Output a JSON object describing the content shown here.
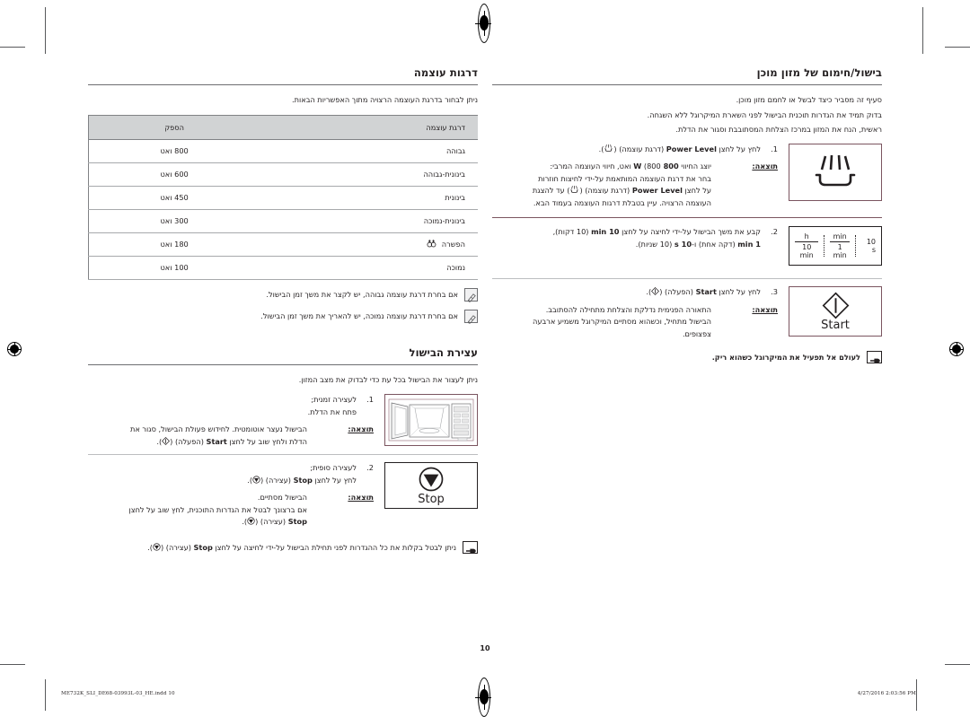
{
  "document": {
    "page_number": "10",
    "footer_filename": "ME732K_SLI_DE68-03993L-03_HE.indd   10",
    "footer_timestamp": "4/27/2016   2:03:56 PM"
  },
  "left_column": {
    "power_section": {
      "title": "דרגות עוצמה",
      "intro": "ניתן לבחור בדרגת העוצמה הרצויה מתוך האפשריות הבאות.",
      "table": {
        "headers": [
          "דרגת עוצמה",
          "הספק"
        ],
        "rows": [
          {
            "level": "גבוהה",
            "level_icon": "",
            "power": "800 ואט"
          },
          {
            "level": "בינונית-גבוהה",
            "level_icon": "",
            "power": "600 ואט"
          },
          {
            "level": "בינונית",
            "level_icon": "",
            "power": "450 ואט"
          },
          {
            "level": "בינונית-נמוכה",
            "level_icon": "",
            "power": "300 ואט"
          },
          {
            "level": "הפשרה",
            "level_icon": "defrost-icon",
            "power": "180 ואט"
          },
          {
            "level": "נמוכה",
            "level_icon": "",
            "power": "100 ואט"
          }
        ]
      },
      "notes": [
        "אם בחרת דרגת עוצמה גבוהה, יש לקצר את משך זמן הבישול.",
        "אם בחרת דרגת עוצמה נמוכה, יש להאריך את משך זמן הבישול."
      ]
    },
    "stop_section": {
      "title": "עצירת הבישול",
      "intro": "ניתן לעצור את הבישול בכל עת כדי לבדוק את מצב המזון.",
      "steps": [
        {
          "num": "1.",
          "lines": [
            "לעצירה זמנית;",
            "פתח את הדלת."
          ],
          "result_label": "תוצאה:",
          "result_lines": [
            "הבישול נעצר אוטומטית. לחידוש פעולת הבישול, סגור את",
            "הדלת ולחץ שוב על לחצן Start (הפעלה) (   )."
          ],
          "figure": "microwave-open-door"
        },
        {
          "num": "2.",
          "lines": [
            "לעצירה סופית;",
            "לחץ על לחצן Stop (עצירה) (   )."
          ],
          "result_label": "תוצאה:",
          "result_lines": [
            "הבישול מסתיים.",
            "אם ברצונך לבטל את הגדרות התוכנית, לחץ שוב על לחצן",
            "Stop (עצירה) (   )."
          ],
          "figure": "stop-button"
        }
      ],
      "final_note": "ניתן לבטל בקלות את כל ההגדרות לפני תחילת הבישול על-ידי לחיצה על לחצן Stop (עצירה) (   )."
    }
  },
  "right_column": {
    "title": "בישול/חימום של מזון מוכן",
    "intro_lines": [
      "סעיף זה מסביר כיצד לבשל או לחמם מזון מוכן.",
      "בדוק תמיד את הגדרות תוכנית הבישול לפני השארת המיקרוגל ללא השגחה.",
      "ראשית, הנח את המזון במרכז הצלחת המסתובבת וסגור את הדלת."
    ],
    "steps": [
      {
        "num": "1.",
        "text": "לחץ על לחצן Power Level (דרגת עוצמה) (   ).",
        "result_label": "תוצאה:",
        "result_lines": [
          "יוצג החיווי 800 W (800 ואט, חיווי העוצמה המרבי:",
          "בחר את דרגת העוצמה המותאמת על-ידי לחיצות חוזרות",
          "על לחצן Power Level (דרגת עוצמה) (   ) עד להצגת",
          "העוצמה הרצויה. עיין בטבלת דרגות העוצמה בעמוד הבא."
        ],
        "figure": "power-level-icon"
      },
      {
        "num": "2.",
        "text": "קבע את משך הבישול על-ידי לחיצה על לחצן 10 min (10 דקות),",
        "text2": "1 min (דקה אחת) ו-10 s (10 שניות).",
        "figure": "timer-icon",
        "figure_labels": {
          "hour_top": "h",
          "hour_bottom": "10 min",
          "min_top": "min",
          "min_bottom": "1 min",
          "sec": "10 s"
        }
      },
      {
        "num": "3.",
        "text": "לחץ על לחצן Start (הפעלה) (   ).",
        "result_label": "תוצאה:",
        "result_lines": [
          "התאורה הפנימית נדלקת והצלחת מתחילה להסתובב.",
          "הבישול מתחיל, וכשהוא מסתיים המיקרוגל משמיע ארבעה",
          "צפצופים."
        ],
        "figure": "start-button",
        "figure_label": "Start"
      }
    ],
    "final_note": "לעולם אל תפעיל את המיקרוגל כשהוא ריק."
  },
  "colors": {
    "text": "#231f20",
    "rule_dark": "#6d6e71",
    "rule_light": "#bcbec0",
    "table_header_bg": "#d1d3d4",
    "maroon": "#7b5560"
  }
}
